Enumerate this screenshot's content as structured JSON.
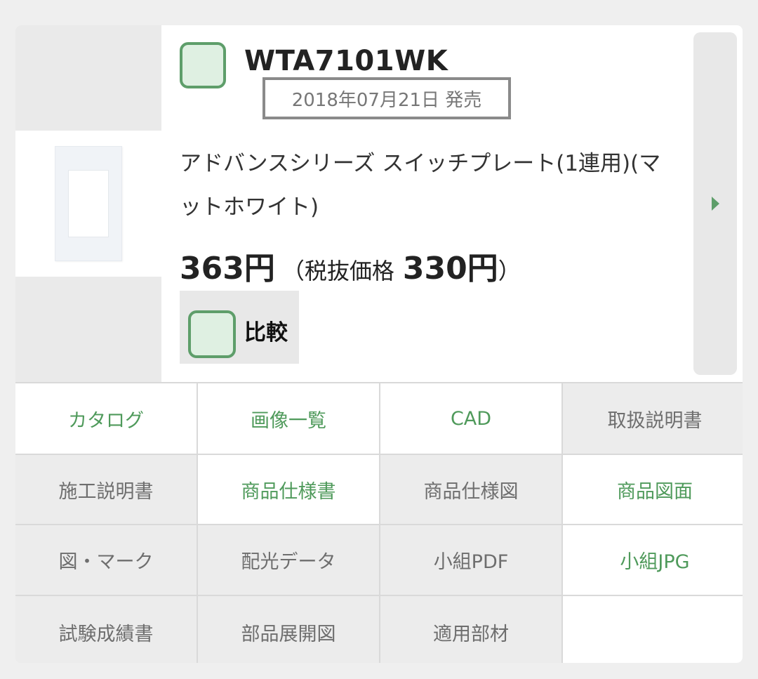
{
  "product": {
    "model": "WTA7101WK",
    "release": "2018年07月21日 発売",
    "name": "アドバンスシリーズ スイッチプレート(1連用)(マットホワイト)",
    "price_with_tax": "363円",
    "price_open": "（税抜価格",
    "price_without_tax": "330円",
    "price_close": "）",
    "compare_label": "比較"
  },
  "colors": {
    "accent": "#4f9a5b",
    "checkbox_border": "#5e9e6a",
    "checkbox_fill": "#dff0e2",
    "disabled_text": "#6e6e6e",
    "disabled_bg": "#ececec"
  },
  "links": [
    {
      "label": "カタログ",
      "enabled": true
    },
    {
      "label": "画像一覧",
      "enabled": true
    },
    {
      "label": "CAD",
      "enabled": true
    },
    {
      "label": "取扱説明書",
      "enabled": false
    },
    {
      "label": "施工説明書",
      "enabled": false
    },
    {
      "label": "商品仕様書",
      "enabled": true
    },
    {
      "label": "商品仕様図",
      "enabled": false
    },
    {
      "label": "商品図面",
      "enabled": true
    },
    {
      "label": "図・マーク",
      "enabled": false
    },
    {
      "label": "配光データ",
      "enabled": false
    },
    {
      "label": "小組PDF",
      "enabled": false
    },
    {
      "label": "小組JPG",
      "enabled": true
    },
    {
      "label": "試験成績書",
      "enabled": false
    },
    {
      "label": "部品展開図",
      "enabled": false
    },
    {
      "label": "適用部材",
      "enabled": false
    },
    {
      "label": "",
      "enabled": false
    }
  ],
  "icons": {
    "next": "caret-right-icon",
    "checkbox": "checkbox-icon"
  }
}
